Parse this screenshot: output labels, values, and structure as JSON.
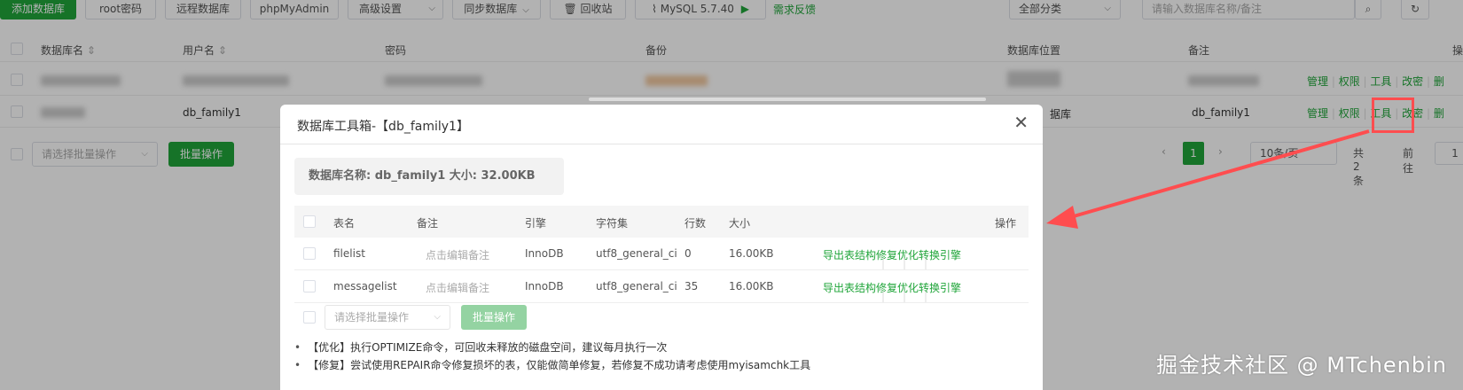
{
  "toolbar": {
    "add_db": "添加数据库",
    "root_pwd": "root密码",
    "remote_db": "远程数据库",
    "phpmyadmin": "phpMyAdmin",
    "advanced": "高级设置",
    "sync_db": "同步数据库",
    "recycle": "回收站",
    "mysql_version": "MySQL 5.7.40",
    "feedback": "需求反馈",
    "category": "全部分类",
    "search_placeholder": "请输入数据库名称/备注"
  },
  "grid": {
    "headers": {
      "db_name": "数据库名",
      "user": "用户名",
      "password": "密码",
      "backup": "备份",
      "location": "数据库位置",
      "remark": "备注",
      "ops": "操"
    },
    "rows": [
      {
        "db_name": "",
        "user": "",
        "remark": ""
      },
      {
        "db_name": "",
        "user": "db_family1",
        "location": "据库",
        "remark": "db_family1"
      }
    ],
    "actions": [
      "管理",
      "权限",
      "工具",
      "改密",
      "删"
    ],
    "batch_placeholder": "请选择批量操作",
    "batch_button": "批量操作",
    "pager": {
      "current": "1",
      "page_size": "10条/页",
      "total": "共 2 条",
      "goto_label": "前往",
      "goto_value": "1"
    }
  },
  "modal": {
    "title": "数据库工具箱-【db_family1】",
    "info": "数据库名称: db_family1 大小: 32.00KB",
    "columns": [
      "表名",
      "备注",
      "引擎",
      "字符集",
      "行数",
      "大小",
      "操作"
    ],
    "rows": [
      {
        "name": "filelist",
        "note": "点击编辑备注",
        "engine": "InnoDB",
        "charset": "utf8_general_ci",
        "rows": "0",
        "size": "16.00KB"
      },
      {
        "name": "messagelist",
        "note": "点击编辑备注",
        "engine": "InnoDB",
        "charset": "utf8_general_ci",
        "rows": "35",
        "size": "16.00KB"
      }
    ],
    "row_actions": [
      "导出表结构",
      "修复",
      "优化",
      "转换引擎"
    ],
    "batch_placeholder": "请选择批量操作",
    "batch_button": "批量操作",
    "tips": [
      "【优化】执行OPTIMIZE命令，可回收未释放的磁盘空间，建议每月执行一次",
      "【修复】尝试使用REPAIR命令修复损坏的表，仅能做简单修复，若修复不成功请考虑使用myisamchk工具"
    ]
  },
  "watermark": "掘金技术社区 @ MTchenbin",
  "colors": {
    "accent": "#20a53a",
    "highlight": "#ff4d4f"
  }
}
